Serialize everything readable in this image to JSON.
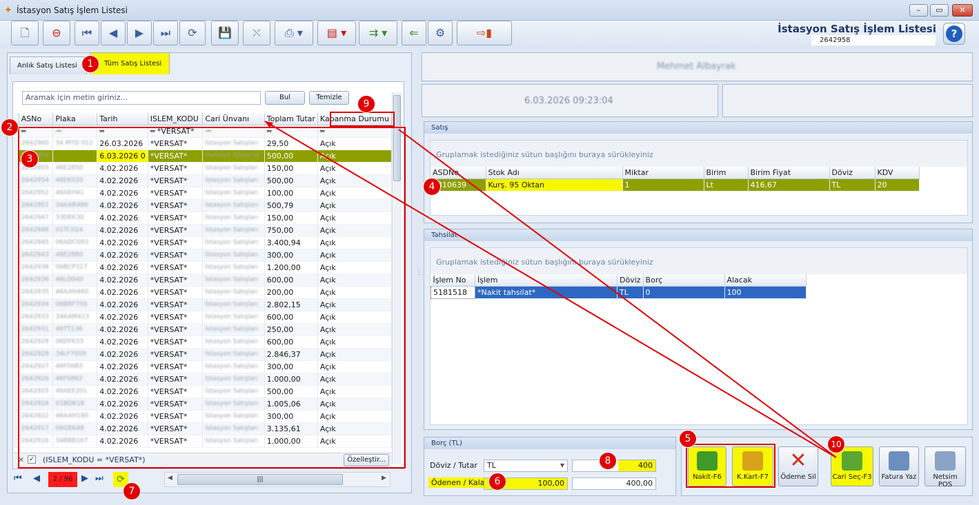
{
  "window": {
    "title": "İstasyon Satış İşlem Listesi"
  },
  "header": {
    "title": "İstasyon Satış İşlem Listesi",
    "record_no": "2642958"
  },
  "tabs": [
    {
      "label": "Anlık Satış Listesi"
    },
    {
      "label": "Tüm Satış Listesi"
    }
  ],
  "search": {
    "placeholder": "Aramak için metin giriniz...",
    "find_label": "Bul",
    "clear_label": "Temizle"
  },
  "grid": {
    "columns": [
      "ASNo",
      "Plaka",
      "Tarih",
      "ISLEM_KODU",
      "Cari Ünvanı",
      "Toplam Tutar",
      "Kapanma Durumu"
    ],
    "filter_value": "*VERSAT*",
    "filter_text": "(ISLEM_KODU = *VERSAT*)",
    "customize_label": "Özelleştir...",
    "rows": [
      {
        "asno": "2642960",
        "plaka": "34 MYD 012",
        "tarih": "26.03.2026",
        "kod": "*VERSAT*",
        "cari": "İstasyon Satışları",
        "tutar": "29,50",
        "durum": "Açık"
      },
      {
        "asno": "2642958",
        "plaka": "",
        "tarih": "6.03.2026 0",
        "kod": "*VERSAT*",
        "cari": "Mehmet Albayrak",
        "tutar": "500,00",
        "durum": "Açık"
      },
      {
        "asno": "2642955",
        "plaka": "46E2850",
        "tarih": "4.02.2026",
        "kod": "*VERSAT*",
        "cari": "İstasyon Satışları",
        "tutar": "150,00",
        "durum": "Açık"
      },
      {
        "asno": "2642954",
        "plaka": "46EK020",
        "tarih": "4.02.2026",
        "kod": "*VERSAT*",
        "cari": "İstasyon Satışları",
        "tutar": "500,00",
        "durum": "Açık"
      },
      {
        "asno": "2642952",
        "plaka": "46AEH41",
        "tarih": "4.02.2026",
        "kod": "*VERSAT*",
        "cari": "İstasyon Satışları",
        "tutar": "100,00",
        "durum": "Açık"
      },
      {
        "asno": "2642951",
        "plaka": "34AAR486",
        "tarih": "4.02.2026",
        "kod": "*VERSAT*",
        "cari": "İstasyon Satışları",
        "tutar": "500,79",
        "durum": "Açık"
      },
      {
        "asno": "2642947",
        "plaka": "33DEK30",
        "tarih": "4.02.2026",
        "kod": "*VERSAT*",
        "cari": "İstasyon Satışları",
        "tutar": "150,00",
        "durum": "Açık"
      },
      {
        "asno": "2642946",
        "plaka": "01TC024",
        "tarih": "4.02.2026",
        "kod": "*VERSAT*",
        "cari": "İstasyon Satışları",
        "tutar": "750,00",
        "durum": "Açık"
      },
      {
        "asno": "2642945",
        "plaka": "06ADC083",
        "tarih": "4.02.2026",
        "kod": "*VERSAT*",
        "cari": "İstasyon Satışları",
        "tutar": "3.400,94",
        "durum": "Açık"
      },
      {
        "asno": "2642943",
        "plaka": "46E2880",
        "tarih": "4.02.2026",
        "kod": "*VERSAT*",
        "cari": "İstasyon Satışları",
        "tutar": "300,00",
        "durum": "Açık"
      },
      {
        "asno": "2642938",
        "plaka": "06BCP317",
        "tarih": "4.02.2026",
        "kod": "*VERSAT*",
        "cari": "İstasyon Satışları",
        "tutar": "1.200,00",
        "durum": "Açık"
      },
      {
        "asno": "2642936",
        "plaka": "46LD040",
        "tarih": "4.02.2026",
        "kod": "*VERSAT*",
        "cari": "İstasyon Satışları",
        "tutar": "600,00",
        "durum": "Açık"
      },
      {
        "asno": "2642935",
        "plaka": "46AAH460",
        "tarih": "4.02.2026",
        "kod": "*VERSAT*",
        "cari": "İstasyon Satışları",
        "tutar": "200,00",
        "durum": "Açık"
      },
      {
        "asno": "2642934",
        "plaka": "06BRF750",
        "tarih": "4.02.2026",
        "kod": "*VERSAT*",
        "cari": "İstasyon Satışları",
        "tutar": "2.802,15",
        "durum": "Açık"
      },
      {
        "asno": "2642933",
        "plaka": "34AAM413",
        "tarih": "4.02.2026",
        "kod": "*VERSAT*",
        "cari": "İstasyon Satışları",
        "tutar": "600,00",
        "durum": "Açık"
      },
      {
        "asno": "2642931",
        "plaka": "46TT136",
        "tarih": "4.02.2026",
        "kod": "*VERSAT*",
        "cari": "İstasyon Satışları",
        "tutar": "250,00",
        "durum": "Açık"
      },
      {
        "asno": "2642929",
        "plaka": "06DY633",
        "tarih": "4.02.2026",
        "kod": "*VERSAT*",
        "cari": "İstasyon Satışları",
        "tutar": "600,00",
        "durum": "Açık"
      },
      {
        "asno": "2642928",
        "plaka": "34LF7009",
        "tarih": "4.02.2026",
        "kod": "*VERSAT*",
        "cari": "İstasyon Satışları",
        "tutar": "2.846,37",
        "durum": "Açık"
      },
      {
        "asno": "2642927",
        "plaka": "46F0083",
        "tarih": "4.02.2026",
        "kod": "*VERSAT*",
        "cari": "İstasyon Satışları",
        "tutar": "300,00",
        "durum": "Açık"
      },
      {
        "asno": "2642926",
        "plaka": "46F0862",
        "tarih": "4.02.2026",
        "kod": "*VERSAT*",
        "cari": "İstasyon Satışları",
        "tutar": "1.000,00",
        "durum": "Açık"
      },
      {
        "asno": "2642925",
        "plaka": "46AEE201",
        "tarih": "4.02.2026",
        "kod": "*VERSAT*",
        "cari": "İstasyon Satışları",
        "tutar": "500,00",
        "durum": "Açık"
      },
      {
        "asno": "2642924",
        "plaka": "01BDK18",
        "tarih": "4.02.2026",
        "kod": "*VERSAT*",
        "cari": "İstasyon Satışları",
        "tutar": "1.005,06",
        "durum": "Açık"
      },
      {
        "asno": "2642922",
        "plaka": "46AAH180",
        "tarih": "4.02.2026",
        "kod": "*VERSAT*",
        "cari": "İstasyon Satışları",
        "tutar": "300,00",
        "durum": "Açık"
      },
      {
        "asno": "2642917",
        "plaka": "06GEK48",
        "tarih": "4.02.2026",
        "kod": "*VERSAT*",
        "cari": "İstasyon Satışları",
        "tutar": "3.135,61",
        "durum": "Açık"
      },
      {
        "asno": "2642916",
        "plaka": "34BBB167",
        "tarih": "4.02.2026",
        "kod": "*VERSAT*",
        "cari": "İstasyon Satışları",
        "tutar": "1.000,00",
        "durum": "Açık"
      }
    ]
  },
  "navigator": {
    "position": "2 / 96"
  },
  "customer": {
    "name": "Mehmet Albayrak",
    "datetime": "6.03.2026 09:23:04"
  },
  "satis": {
    "title": "Satış",
    "group_hint": "Gruplamak istediğiniz sütun başlığını buraya sürükleyiniz",
    "columns": [
      "ASDNo",
      "Stok Adı",
      "Miktar",
      "Birim",
      "Birim Fiyat",
      "Döviz",
      "KDV"
    ],
    "row": {
      "asdno": "4310639",
      "stok": "Kurş. 95 Oktan",
      "miktar": "1",
      "birim": "Lt",
      "fiyat": "416,67",
      "doviz": "TL",
      "kdv": "20"
    }
  },
  "tahsilat": {
    "title": "Tahsilat",
    "group_hint": "Gruplamak istediğiniz sütun başlığını buraya sürükleyiniz",
    "columns": [
      "İşlem No",
      "İşlem",
      "Döviz",
      "Borç",
      "Alacak"
    ],
    "row": {
      "no": "5181518",
      "islem": "*Nakit tahsilat*",
      "doviz": "TL",
      "borc": "0",
      "alacak": "100"
    }
  },
  "borc": {
    "title": "Borç (TL)",
    "doviz_label": "Döviz / Tutar",
    "doviz_value": "TL",
    "tutar_value": "400",
    "odenen_label": "Ödenen / Kalan",
    "odenen_value": "100,00",
    "kalan_value": "400,00"
  },
  "actions": {
    "nakit": "Nakit-F6",
    "kkart": "K.Kart-F7",
    "odeme_sil": "Ödeme Sil",
    "cari_sec": "Cari Seç-F3",
    "fatura": "Fatura Yaz",
    "netsim": "Netsim POS"
  },
  "badges": [
    "1",
    "2",
    "3",
    "4",
    "5",
    "6",
    "7",
    "8",
    "9",
    "10"
  ],
  "colors": {
    "highlight": "#f7f700",
    "selected_row": "#8ea000",
    "annotation": "#e00000",
    "tahsilat_row": "#2d67c3"
  }
}
